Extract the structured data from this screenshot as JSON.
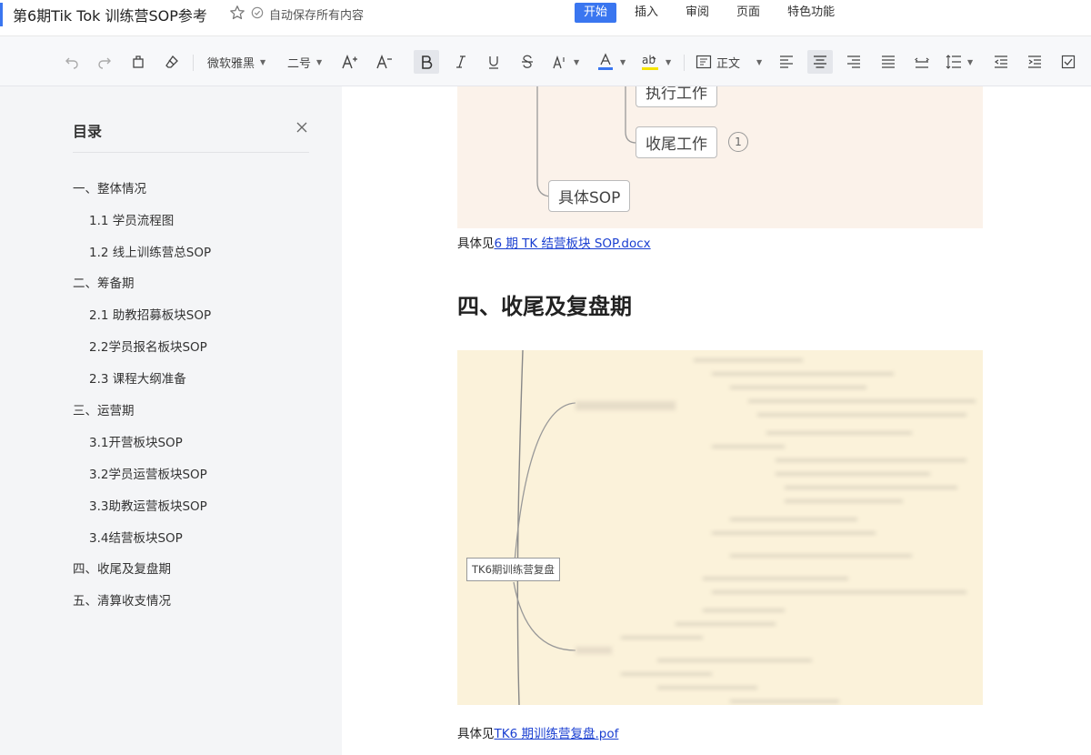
{
  "titlebar": {
    "doc_title": "第6期Tik Tok 训练营SOP参考",
    "save_status": "自动保存所有内容",
    "menu": [
      "开始",
      "插入",
      "审阅",
      "页面",
      "特色功能"
    ]
  },
  "toolbar": {
    "font_family": "微软雅黑",
    "font_size": "二号",
    "paragraph_style": "正文"
  },
  "colors": {
    "accent": "#3a76f0",
    "font_color_bar": "#3a76f0",
    "highlight_bar": "#f5e400"
  },
  "toc": {
    "title": "目录",
    "items": [
      {
        "label": "一、整体情况",
        "level": 1
      },
      {
        "label": "1.1 学员流程图",
        "level": 2
      },
      {
        "label": "1.2 线上训练营总SOP",
        "level": 2
      },
      {
        "label": "二、筹备期",
        "level": 1
      },
      {
        "label": "2.1 助教招募板块SOP",
        "level": 2
      },
      {
        "label": "2.2学员报名板块SOP",
        "level": 2
      },
      {
        "label": "2.3 课程大纲准备",
        "level": 2
      },
      {
        "label": "三、运营期",
        "level": 1
      },
      {
        "label": "3.1开营板块SOP",
        "level": 2
      },
      {
        "label": "3.2学员运营板块SOP",
        "level": 2
      },
      {
        "label": "3.3助教运营板块SOP",
        "level": 2
      },
      {
        "label": "3.4结营板块SOP",
        "level": 2
      },
      {
        "label": "四、收尾及复盘期",
        "level": 1
      },
      {
        "label": "五、清算收支情况",
        "level": 1
      }
    ]
  },
  "document": {
    "mindmap1": {
      "node_top": "执行工作",
      "node_mid": "收尾工作",
      "badge": "1",
      "node_bottom": "具体SOP"
    },
    "para1_prefix": "具体见",
    "para1_link": "6 期 TK 结营板块 SOP.docx",
    "heading": "四、收尾及复盘期",
    "mindmap2_root": "TK6期训练营复盘",
    "para2_prefix": "具体见",
    "para2_link": "TK6 期训练营复盘.pof"
  }
}
